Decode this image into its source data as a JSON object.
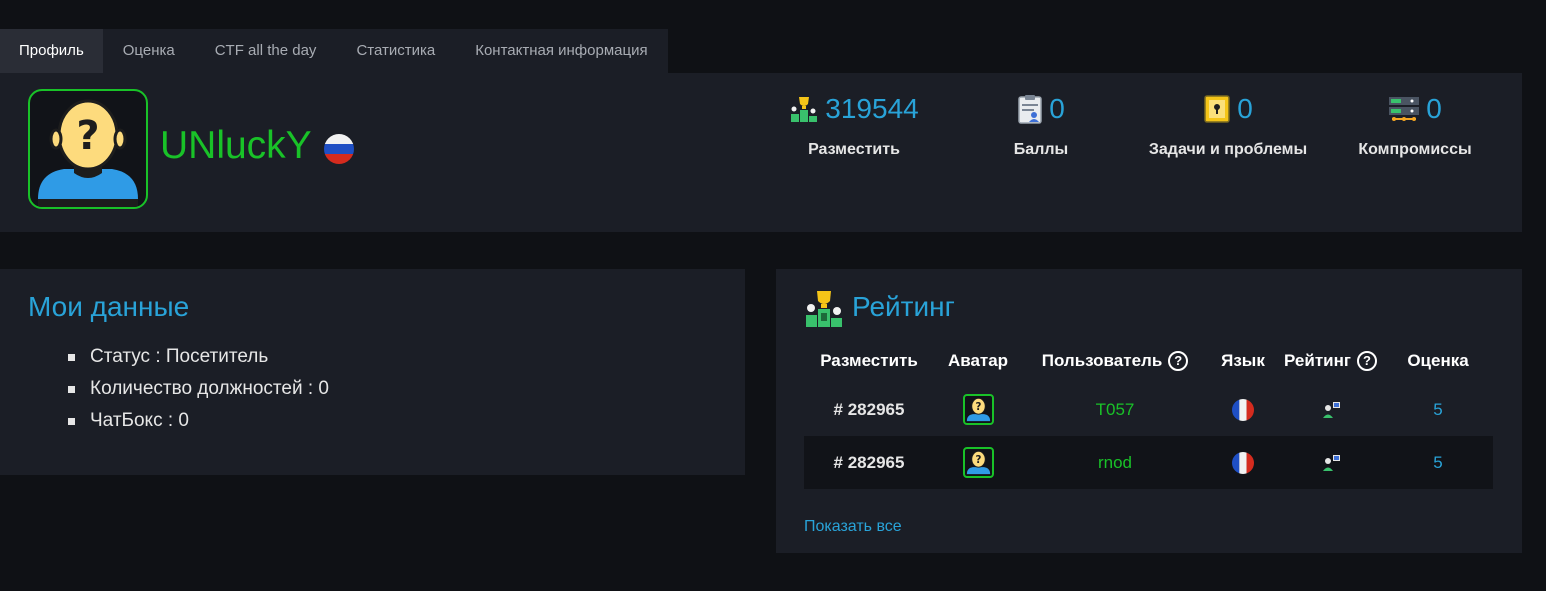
{
  "tabs": [
    "Профиль",
    "Оценка",
    "CTF all the day",
    "Статистика",
    "Контактная информация"
  ],
  "profile": {
    "username": "UNluckY",
    "country_flag": "russia-flag-icon",
    "stats": [
      {
        "icon": "podium-trophy-icon",
        "value": "319544",
        "label": "Разместить"
      },
      {
        "icon": "clipboard-user-icon",
        "value": "0",
        "label": "Баллы"
      },
      {
        "icon": "shield-lock-icon",
        "value": "0",
        "label": "Задачи и проблемы"
      },
      {
        "icon": "server-network-icon",
        "value": "0",
        "label": "Компромиссы"
      }
    ]
  },
  "mydata": {
    "title": "Мои данные",
    "items": [
      "Статус : Посетитель",
      "Количество должностей : 0",
      "ЧатБокс : 0"
    ]
  },
  "rating": {
    "title": "Рейтинг",
    "columns": [
      "Разместить",
      "Аватар",
      "Пользователь",
      "Язык",
      "Рейтинг",
      "Оценка"
    ],
    "help_glyph": "?",
    "rows": [
      {
        "rank": "# 282965",
        "user": "T057",
        "lang": "france-flag-icon",
        "score": "5"
      },
      {
        "rank": "# 282965",
        "user": "rnod",
        "lang": "france-flag-icon",
        "score": "5"
      }
    ],
    "show_all": "Показать все"
  },
  "colors": {
    "accent": "#29a3d8",
    "user_green": "#19c228",
    "panel_bg": "#1b1e26",
    "page_bg": "#0f1115"
  }
}
